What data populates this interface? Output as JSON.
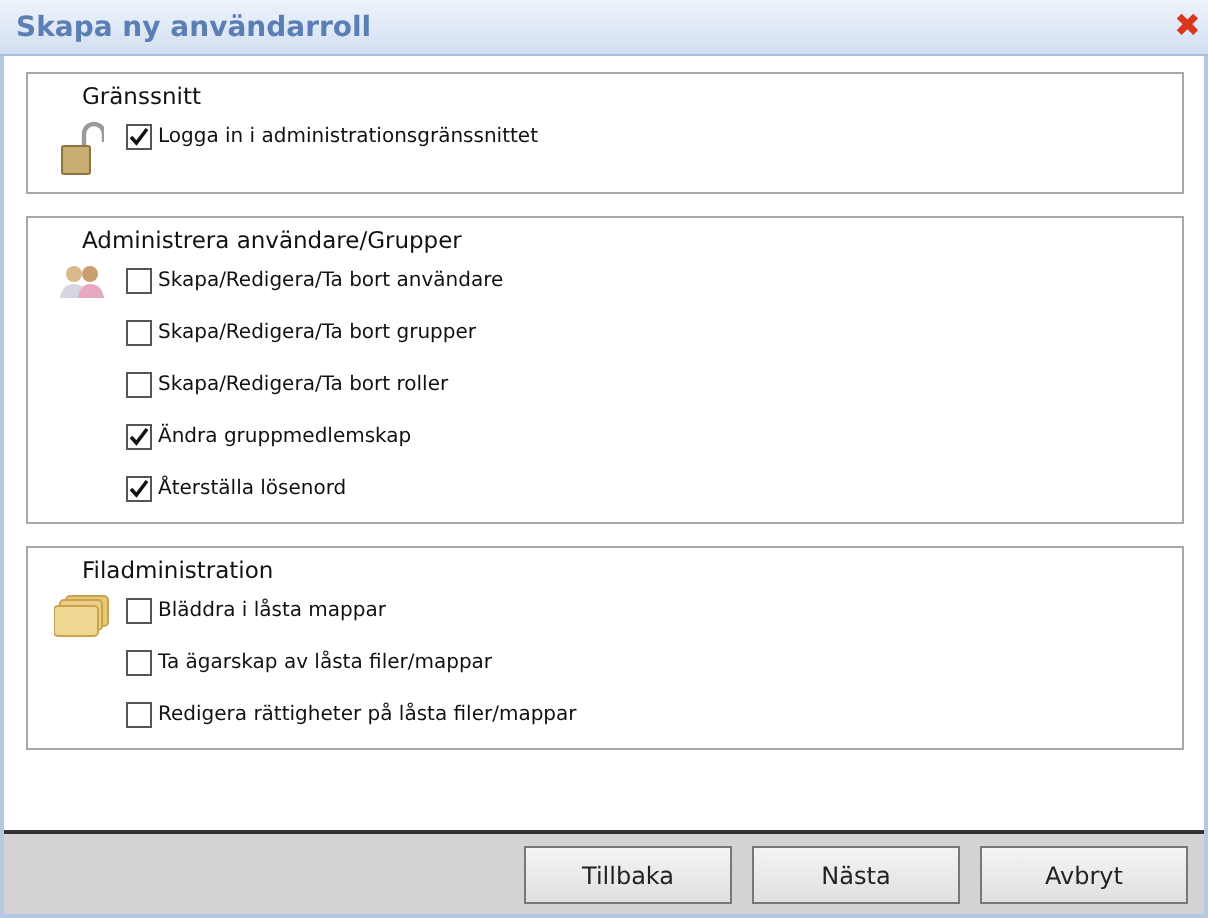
{
  "window": {
    "title": "Skapa ny användarroll",
    "close": "✖"
  },
  "sections": [
    {
      "title": "Gränssnitt",
      "options": [
        {
          "label": "Logga in i administrationsgränssnittet",
          "checked": true
        }
      ]
    },
    {
      "title": "Administrera användare/Grupper",
      "options": [
        {
          "label": "Skapa/Redigera/Ta bort användare",
          "checked": false
        },
        {
          "label": "Skapa/Redigera/Ta bort grupper",
          "checked": false
        },
        {
          "label": "Skapa/Redigera/Ta bort roller",
          "checked": false
        },
        {
          "label": "Ändra gruppmedlemskap",
          "checked": true
        },
        {
          "label": "Återställa lösenord",
          "checked": true
        }
      ]
    },
    {
      "title": "Filadministration",
      "options": [
        {
          "label": "Bläddra i låsta mappar",
          "checked": false
        },
        {
          "label": "Ta ägarskap av låsta filer/mappar",
          "checked": false
        },
        {
          "label": "Redigera rättigheter på låsta filer/mappar",
          "checked": false
        }
      ]
    }
  ],
  "buttons": [
    "Tillbaka",
    "Nästa",
    "Avbryt"
  ]
}
